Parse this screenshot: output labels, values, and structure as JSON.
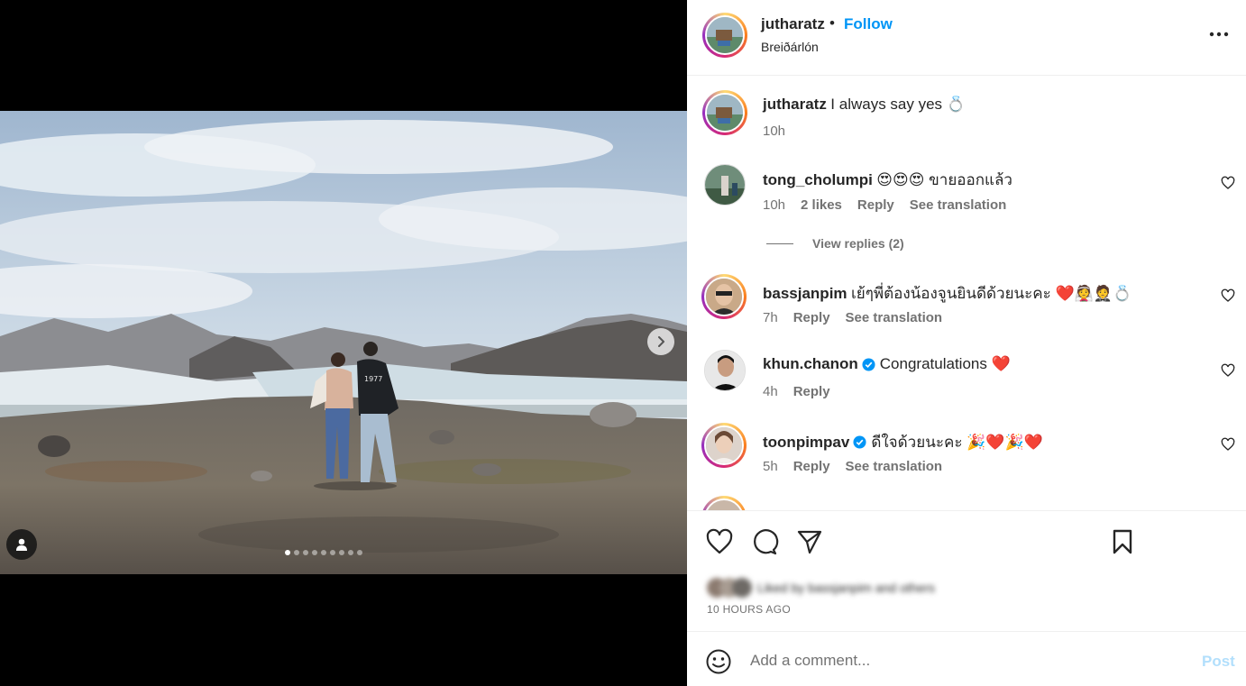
{
  "post": {
    "author": "jutharatz",
    "follow_label": "Follow",
    "separator": "•",
    "location": "Breiðárlón",
    "caption": "I always say yes 💍",
    "caption_time": "10h"
  },
  "media": {
    "slide_count": 9,
    "active_slide": 1,
    "shirt_text": "1977"
  },
  "comments": [
    {
      "user": "tong_cholumpi",
      "text": "😍😍😍 ขายออกแล้ว",
      "time": "10h",
      "likes": "2 likes",
      "reply": "Reply",
      "translate": "See translation"
    },
    {
      "user": "bassjanpim",
      "text": "เย้ๆพี่ต้องน้องจูนยินดีด้วยนะคะ ❤️👰🤵💍",
      "time": "7h",
      "reply": "Reply",
      "translate": "See translation"
    },
    {
      "user": "khun.chanon",
      "text": "Congratulations ❤️",
      "time": "4h",
      "reply": "Reply"
    },
    {
      "user": "toonpimpav",
      "text": "ดีใจด้วยนะคะ 🎉❤️🎉❤️",
      "time": "5h",
      "reply": "Reply",
      "translate": "See translation"
    }
  ],
  "view_replies": "View replies (2)",
  "liked_by": "Liked by bassjanpim and others",
  "timestamp": "10 HOURS AGO",
  "add_comment": {
    "placeholder": "Add a comment...",
    "post_label": "Post"
  },
  "colors": {
    "accent": "#0095f6",
    "post_disabled": "#b2dffc",
    "muted": "#737373",
    "verified": "#0095f6"
  }
}
